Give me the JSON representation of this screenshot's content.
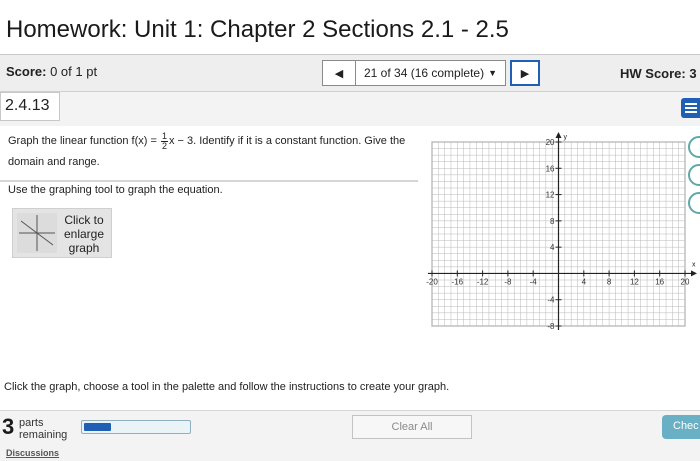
{
  "header": {
    "title": "Homework: Unit 1: Chapter 2 Sections 2.1 - 2.5"
  },
  "score_bar": {
    "score_label": "Score:",
    "score_value": "0 of 1 pt",
    "prev_icon": "triangle-left-icon",
    "question_position": "21 of 34 (16 complete)",
    "dropdown_icon": "triangle-down-icon",
    "next_icon": "triangle-right-icon",
    "hw_score_label": "HW Score: 3"
  },
  "question": {
    "number": "2.4.13",
    "text_before_fraction": "Graph the linear function f(x) = ",
    "fraction_numerator": "1",
    "fraction_denominator": "2",
    "text_after_fraction": "x − 3. Identify if it is a constant function. Give the",
    "text_line2": "domain and range.",
    "instruction": "Use the graphing tool to graph the equation.",
    "enlarge_label": "Click to enlarge graph"
  },
  "graph": {
    "x_ticks": [
      "-20",
      "-16",
      "-12",
      "-8",
      "-4",
      "4",
      "8",
      "12",
      "16",
      "20"
    ],
    "y_ticks": [
      "20",
      "16",
      "12",
      "8",
      "4",
      "-4",
      "-8"
    ],
    "x_axis_label": "x",
    "y_axis_label": "y",
    "x_range": [
      -20,
      20
    ],
    "y_range": [
      -8,
      20
    ]
  },
  "footer": {
    "instructions": "Click the graph, choose a tool in the palette and follow the instructions to create your graph.",
    "parts_count": "3",
    "parts_label_line1": "parts",
    "parts_label_line2": "remaining",
    "progress_fraction": 0.25,
    "clear_all": "Clear All",
    "check": "Chec",
    "discussions": "Discussions"
  },
  "colors": {
    "accent": "#1f5fb5",
    "check_button": "#6ab0c4",
    "grid": "#b8b8b8"
  }
}
